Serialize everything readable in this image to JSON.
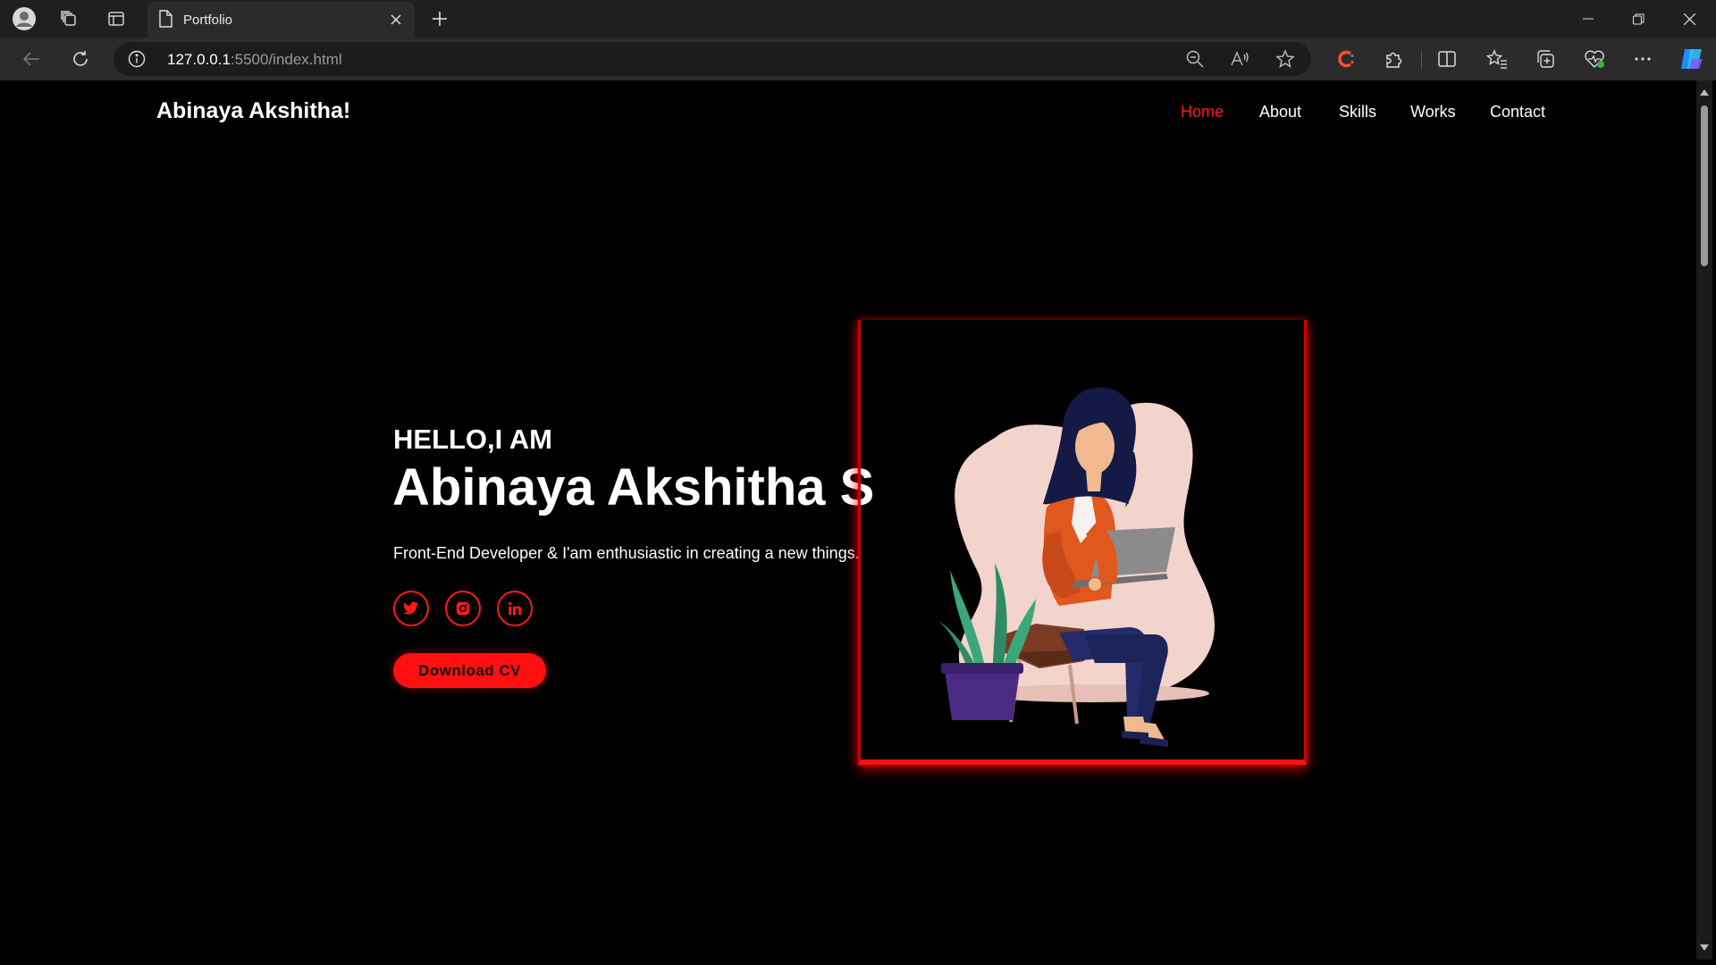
{
  "browser": {
    "tab_title": "Portfolio",
    "url_host": "127.0.0.1",
    "url_rest": ":5500/index.html"
  },
  "site": {
    "logo": "Abinaya Akshitha!",
    "nav": [
      {
        "label": "Home",
        "active": true
      },
      {
        "label": "About",
        "active": false
      },
      {
        "label": "Skills",
        "active": false
      },
      {
        "label": "Works",
        "active": false
      },
      {
        "label": "Contact",
        "active": false
      }
    ],
    "accent_color": "#ff1a1a"
  },
  "hero": {
    "greeting": "HELLO,I AM",
    "name": "Abinaya Akshitha S",
    "tagline": "Front-End Developer & I'am enthusiastic in creating a new things.",
    "social": [
      {
        "icon": "twitter-icon"
      },
      {
        "icon": "instagram-icon"
      },
      {
        "icon": "linkedin-icon"
      }
    ],
    "cv_button": "Download CV"
  }
}
